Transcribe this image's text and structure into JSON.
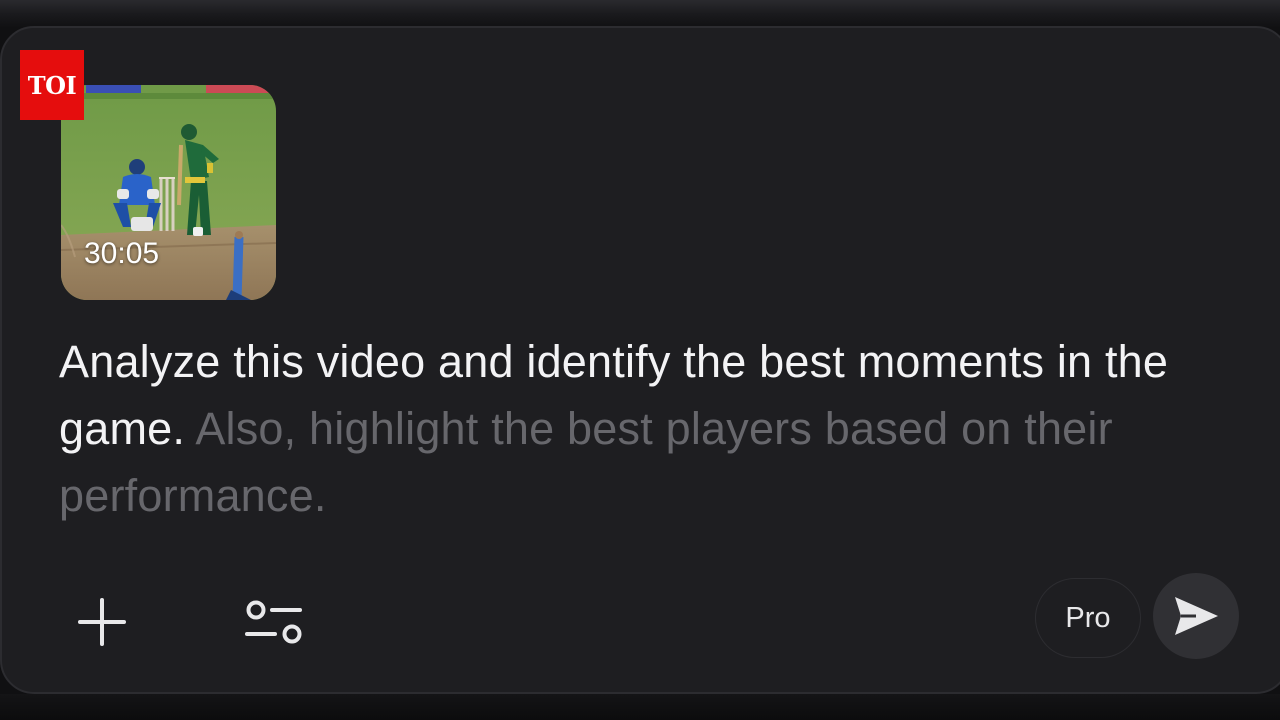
{
  "logo": {
    "text": "TOI",
    "color": "#e50d0d"
  },
  "attachment": {
    "type": "video-thumbnail",
    "duration": "30:05"
  },
  "prompt": {
    "typed_text": "Analyze this video and identify the best moments in the game.",
    "suggested_text": "Also, highlight the best players based on their performance."
  },
  "toolbar": {
    "add_icon": "plus-icon",
    "tools_icon": "sliders-icon",
    "model_label": "Pro",
    "send_icon": "send-arrow-icon"
  },
  "colors": {
    "background": "#1e1e21",
    "typed_text": "#f3f3f5",
    "suggested_text": "#67676c",
    "send_button": "#303034"
  }
}
